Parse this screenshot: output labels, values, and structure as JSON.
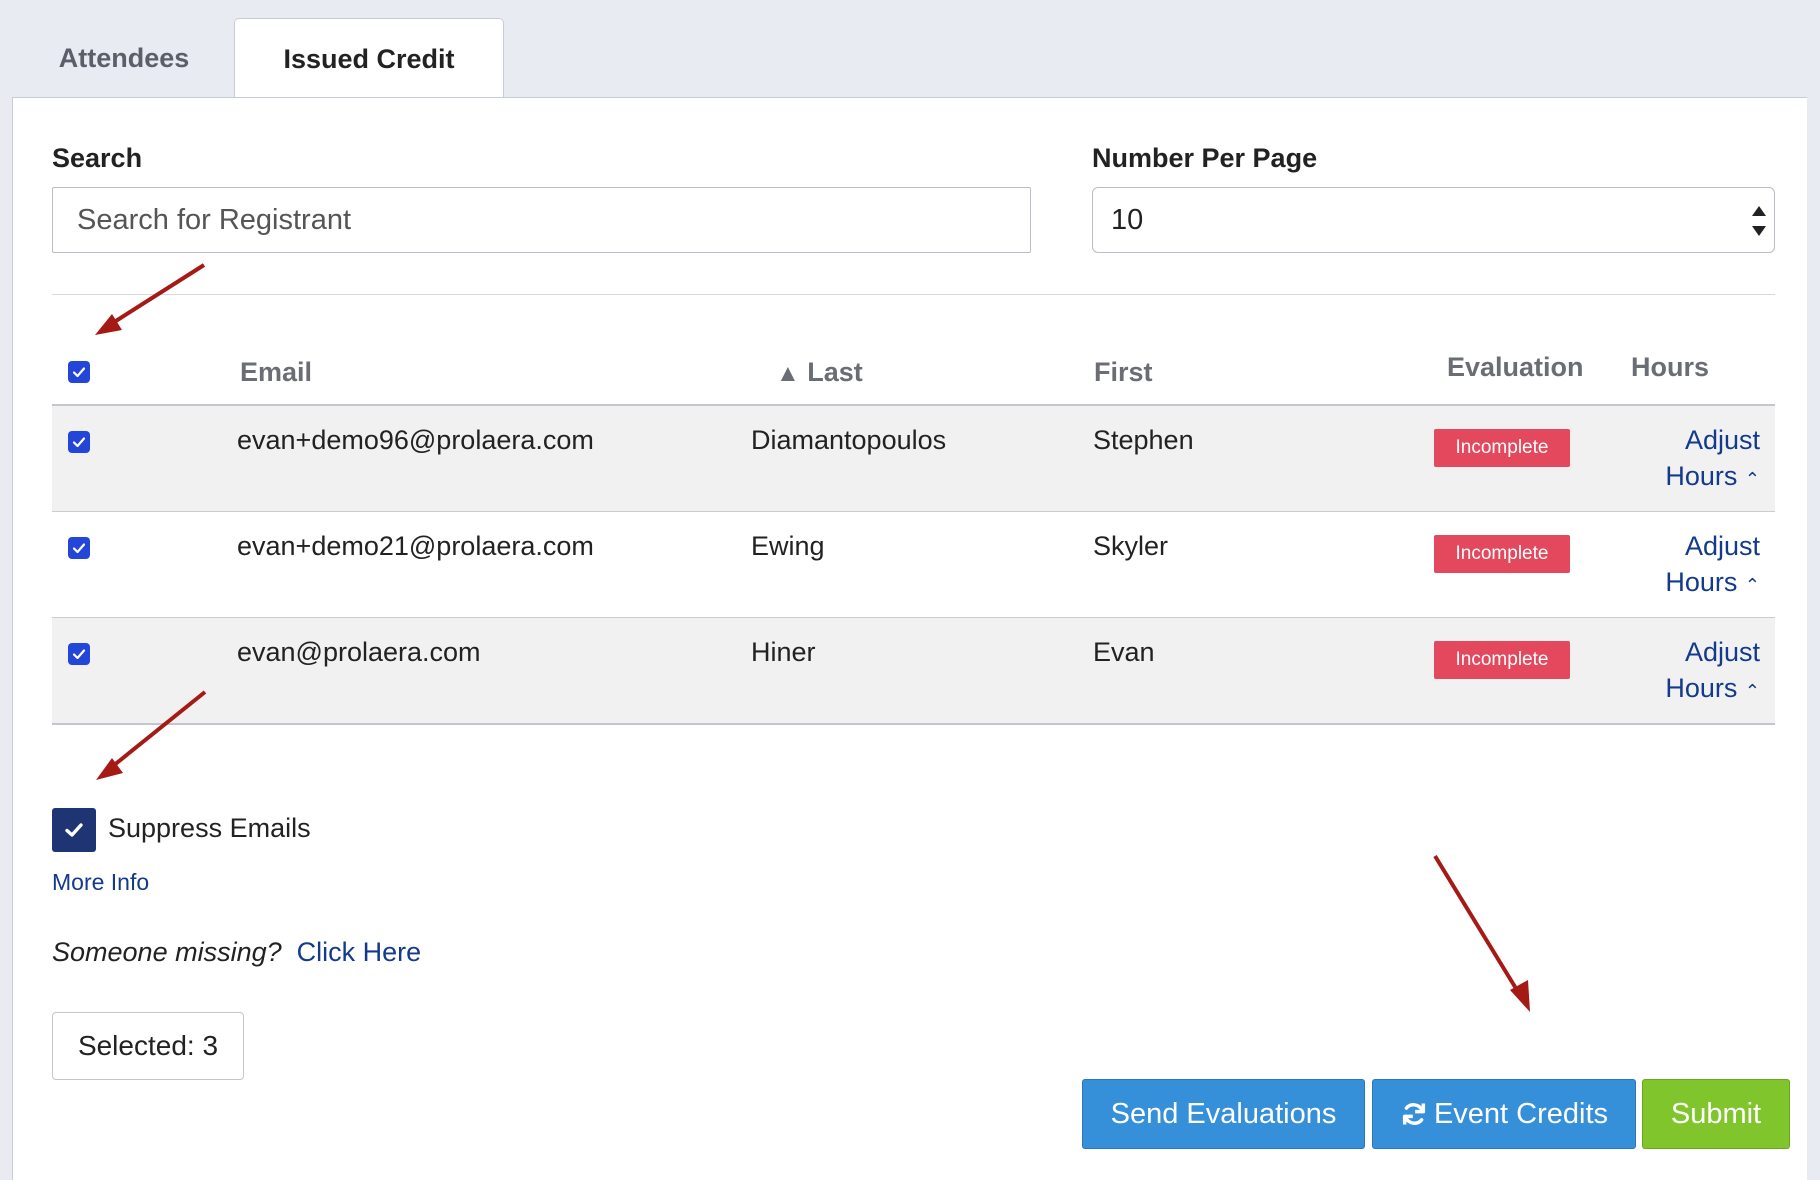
{
  "tabs": [
    {
      "label": "Attendees",
      "active": false
    },
    {
      "label": "Issued Credit",
      "active": true
    }
  ],
  "search": {
    "label": "Search",
    "placeholder": "Search for Registrant"
  },
  "per_page": {
    "label": "Number Per Page",
    "value": "10"
  },
  "table": {
    "headers": {
      "email": "Email",
      "last": "Last",
      "last_sort_indicator": "▲",
      "first": "First",
      "evaluation": "Evaluation",
      "hours": "Hours"
    },
    "select_all_checked": true,
    "rows": [
      {
        "checked": true,
        "email": "evan+demo96@prolaera.com",
        "last": "Diamantopoulos",
        "first": "Stephen",
        "evaluation": "Incomplete",
        "adjust_line1": "Adjust",
        "adjust_line2": "Hours"
      },
      {
        "checked": true,
        "email": "evan+demo21@prolaera.com",
        "last": "Ewing",
        "first": "Skyler",
        "evaluation": "Incomplete",
        "adjust_line1": "Adjust",
        "adjust_line2": "Hours"
      },
      {
        "checked": true,
        "email": "evan@prolaera.com",
        "last": "Hiner",
        "first": "Evan",
        "evaluation": "Incomplete",
        "adjust_line1": "Adjust",
        "adjust_line2": "Hours"
      }
    ]
  },
  "suppress_emails": {
    "label": "Suppress Emails",
    "checked": true
  },
  "more_info": "More Info",
  "missing": {
    "text": "Someone missing?",
    "link": "Click Here"
  },
  "selected": "Selected: 3",
  "buttons": {
    "send_evaluations": "Send Evaluations",
    "event_credits": "Event Credits",
    "submit": "Submit"
  },
  "colors": {
    "accent": "#3690d9",
    "submit": "#80c52b",
    "incomplete": "#e4485c",
    "link": "#143a8c",
    "checkbox": "#2446d8",
    "annotation_arrow": "#a51a14"
  }
}
